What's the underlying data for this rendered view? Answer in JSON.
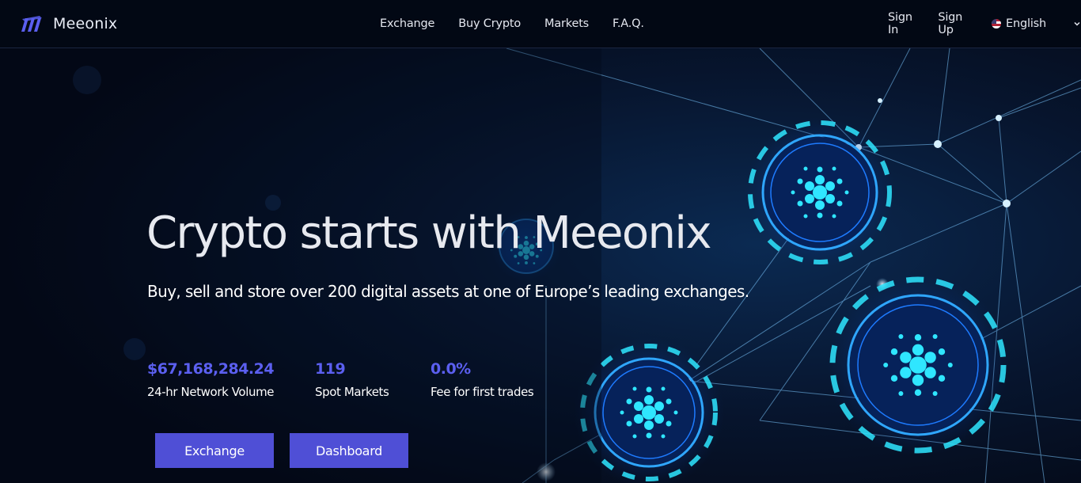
{
  "brand": {
    "name": "Meeonix"
  },
  "nav": {
    "links": [
      "Exchange",
      "Buy Crypto",
      "Markets",
      "F.A.Q."
    ],
    "sign_in": "Sign In",
    "sign_up": "Sign Up",
    "language": "English"
  },
  "hero": {
    "title": "Crypto starts with Meeonix",
    "subtitle": "Buy, sell and store over 200 digital assets at one of Europe’s leading exchanges.",
    "stats": [
      {
        "value": "$67,168,284.24",
        "label": "24-hr Network Volume"
      },
      {
        "value": "119",
        "label": "Spot Markets"
      },
      {
        "value": "0.0%",
        "label": "Fee for first trades"
      }
    ],
    "buttons": {
      "primary": "Exchange",
      "secondary": "Dashboard"
    }
  },
  "icons": {
    "logo": "meeonix-logo-icon",
    "flag": "us-flag-icon",
    "dropdown": "chevron-down-icon"
  },
  "colors": {
    "background": "#050b1a",
    "header": "#020814",
    "accent": "#5b5ff0",
    "button": "#4f4fd6",
    "glow": "#2fd4ff"
  }
}
